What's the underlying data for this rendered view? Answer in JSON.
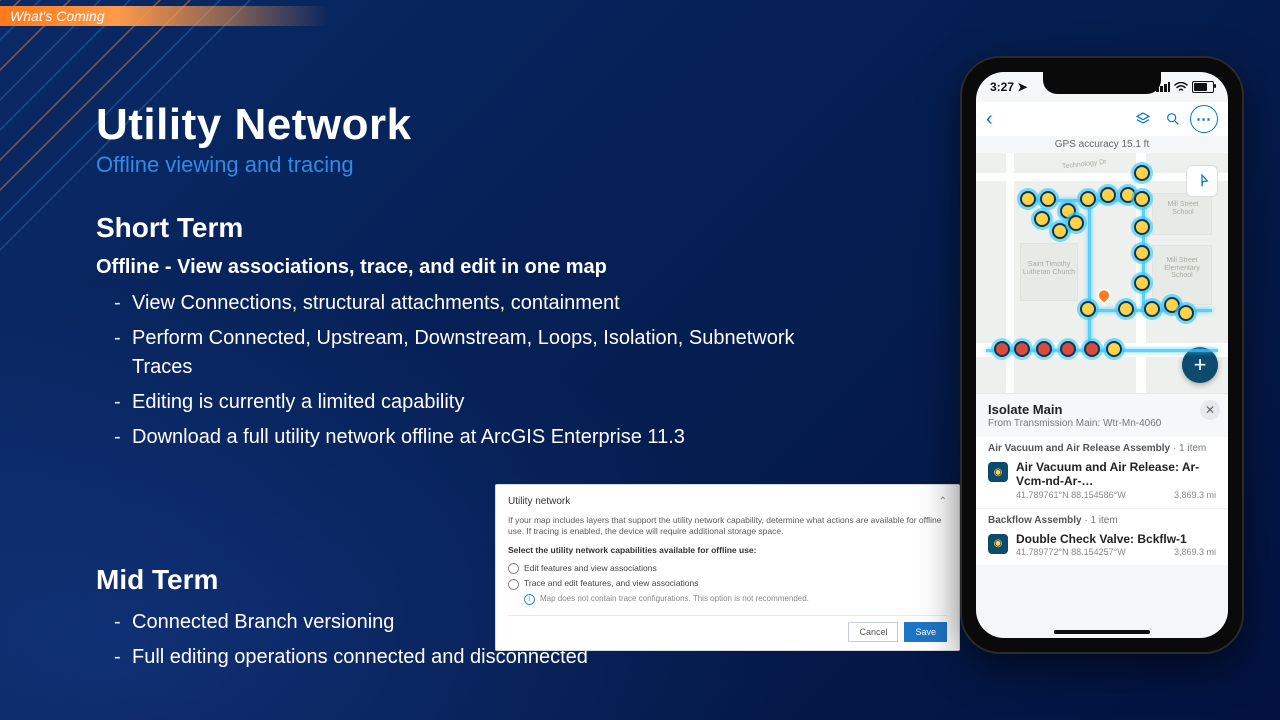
{
  "banner": "What's Coming",
  "title": "Utility Network",
  "subtitle": "Offline viewing and tracing",
  "short_term": {
    "header": "Short Term",
    "subheader": "Offline - View associations, trace, and edit in one map",
    "bullets": [
      "View Connections, structural attachments, containment",
      "Perform Connected, Upstream, Downstream, Loops, Isolation, Subnetwork Traces",
      "Editing is currently a limited capability",
      "Download a full utility network offline at ArcGIS Enterprise 11.3"
    ]
  },
  "mid_term": {
    "header": "Mid Term",
    "bullets": [
      "Connected Branch versioning",
      "Full editing operations connected and disconnected"
    ]
  },
  "dialog": {
    "title": "Utility network",
    "description": "If your map includes layers that support the utility network capability, determine what actions are available for offline use. If tracing is enabled, the device will require additional storage space.",
    "select_label": "Select the utility network capabilities available for offline use:",
    "option1": "Edit features and view associations",
    "option2": "Trace and edit features, and view associations",
    "info": "Map does not contain trace configurations. This option is not recommended.",
    "cancel": "Cancel",
    "save": "Save"
  },
  "phone": {
    "time": "3:27",
    "gps_banner": "GPS accuracy 15.1 ft",
    "map_labels": {
      "church": "Saint Timothy Lutheran Church",
      "school1": "Mill Street School",
      "school2": "Mill Street Elementary School",
      "tech": "Technology Dr"
    },
    "panel": {
      "title": "Isolate Main",
      "subtitle": "From Transmission Main: Wtr-Mn-4060",
      "group1": {
        "label_name": "Air Vacuum and Air Release Assembly",
        "label_count": "1 item",
        "item_title": "Air Vacuum and Air Release: Ar-Vcm-nd-Ar-…",
        "coords": "41.789761°N  88.154586°W",
        "distance": "3,869.3 mi"
      },
      "group2": {
        "label_name": "Backflow Assembly",
        "label_count": "1 item",
        "item_title": "Double Check Valve: Bckflw-1",
        "coords": "41.789772°N  88.154257°W",
        "distance": "3,869.3 mi"
      }
    }
  }
}
